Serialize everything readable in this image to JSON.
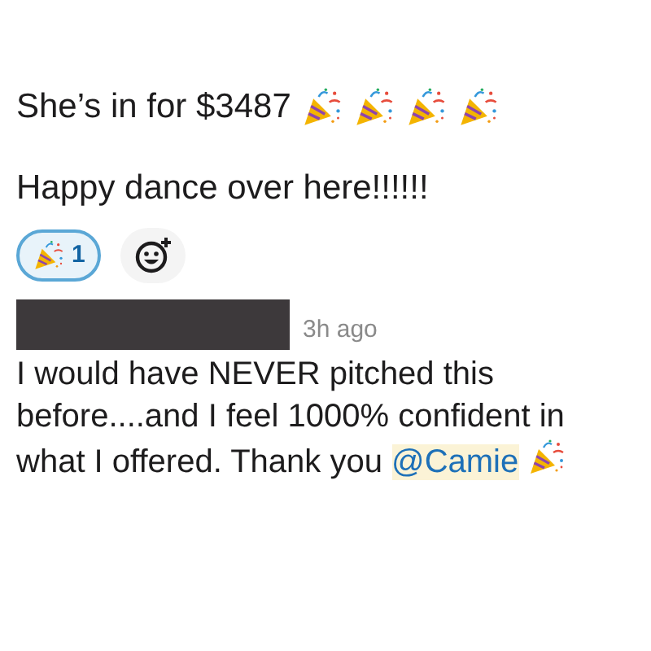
{
  "messages": [
    {
      "lines": [
        "She’s in for $3487",
        "Happy dance over here!!!!!!"
      ],
      "reactions": [
        {
          "count": "1",
          "selected": true
        }
      ]
    },
    {
      "time": "3h ago",
      "text": "I would have NEVER pitched this before....and I feel 1000% confident in what I offered. Thank you ",
      "mention": "@Camie"
    }
  ]
}
